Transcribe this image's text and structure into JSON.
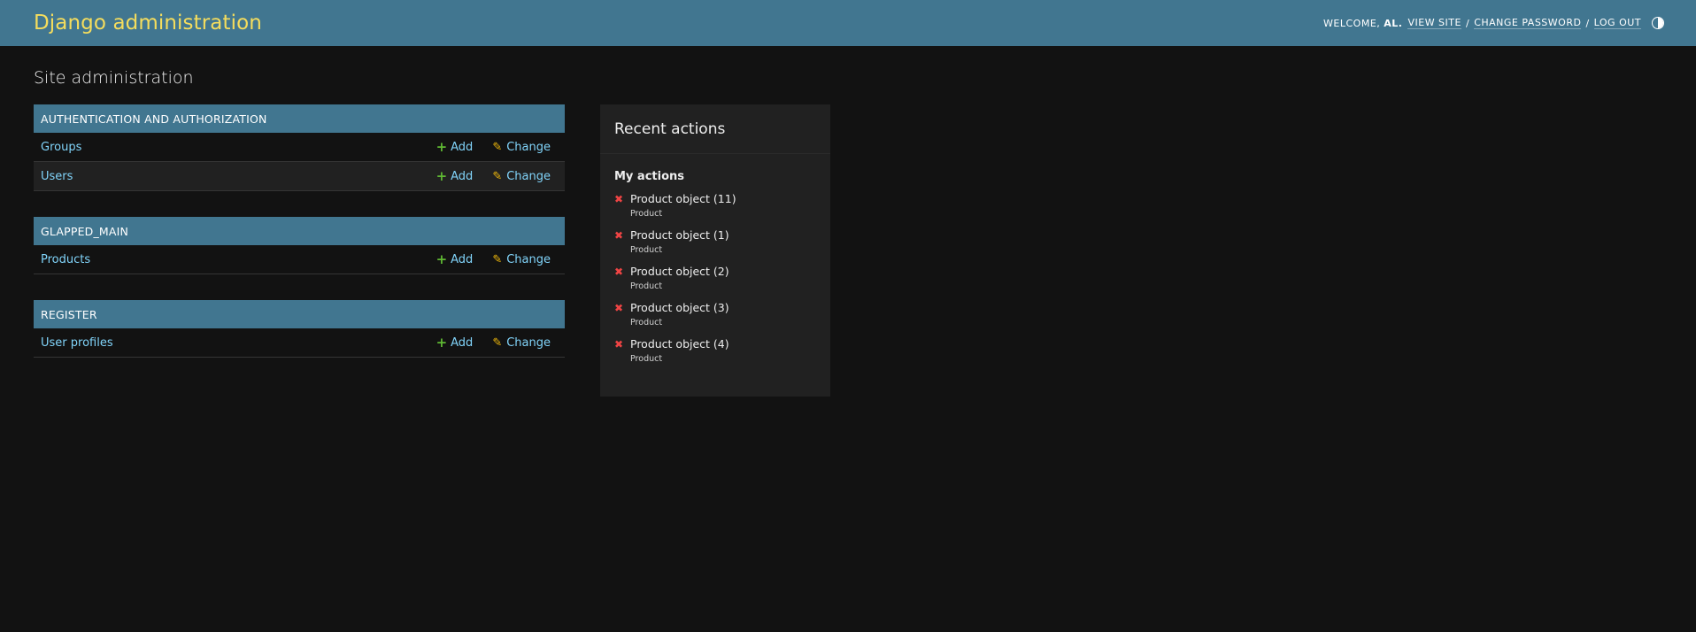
{
  "header": {
    "branding": "Django administration",
    "welcome": "WELCOME,",
    "user": "AL.",
    "view_site": "VIEW SITE",
    "change_password": "CHANGE PASSWORD",
    "log_out": "LOG OUT",
    "separator": "/"
  },
  "page_title": "Site administration",
  "action_labels": {
    "add": "Add",
    "change": "Change"
  },
  "modules": [
    {
      "caption": "AUTHENTICATION AND AUTHORIZATION",
      "models": [
        "Groups",
        "Users"
      ]
    },
    {
      "caption": "GLAPPED_MAIN",
      "models": [
        "Products"
      ]
    },
    {
      "caption": "REGISTER",
      "models": [
        "User profiles"
      ]
    }
  ],
  "recent": {
    "title": "Recent actions",
    "subtitle": "My actions",
    "items": [
      {
        "title": "Product object (11)",
        "type": "Product"
      },
      {
        "title": "Product object (1)",
        "type": "Product"
      },
      {
        "title": "Product object (2)",
        "type": "Product"
      },
      {
        "title": "Product object (3)",
        "type": "Product"
      },
      {
        "title": "Product object (4)",
        "type": "Product"
      }
    ]
  },
  "colors": {
    "header_bg": "#417690",
    "branding": "#f5dd5d",
    "link": "#81d4fa",
    "add_icon": "#5fb833",
    "change_icon": "#efb80b",
    "delete_icon": "#ef4444"
  },
  "icons": {
    "add": "plus-icon",
    "change": "pencil-icon",
    "delete": "cross-icon",
    "theme": "half-circle-icon"
  }
}
